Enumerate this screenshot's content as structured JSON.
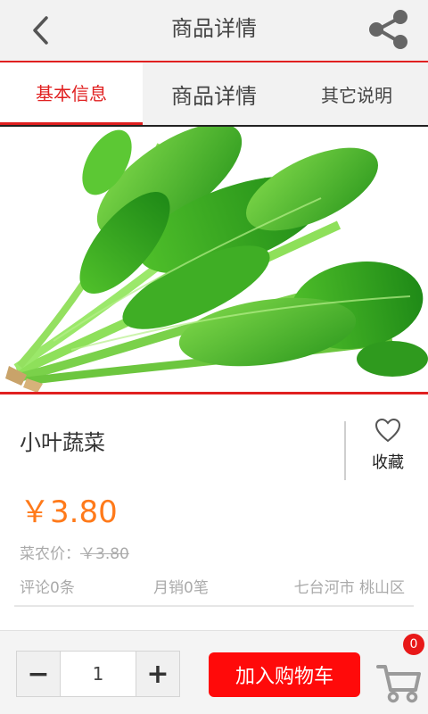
{
  "header": {
    "title": "商品详情",
    "back_icon": "chevron-left-icon",
    "share_icon": "share-icon"
  },
  "tabs": [
    {
      "label": "基本信息",
      "active": true
    },
    {
      "label": "商品详情",
      "active": false
    },
    {
      "label": "其它说明",
      "active": false
    }
  ],
  "product": {
    "name": "小叶蔬菜",
    "price": "￥3.80",
    "farmer_price_label": "菜农价：",
    "farmer_price": "￥3.80",
    "favorite_label": "收藏",
    "favorite_icon": "heart-outline-icon",
    "comments": "评论0条",
    "monthly_sales": "月销0笔",
    "location": "七台河市 桃山区"
  },
  "bottom": {
    "minus": "−",
    "quantity": "1",
    "plus": "+",
    "add_to_cart": "加入购物车",
    "cart_badge": "0",
    "cart_icon": "shopping-cart-icon"
  },
  "colors": {
    "accent": "#e02020",
    "price": "#ff7a1a",
    "button": "#ff0a0a"
  }
}
